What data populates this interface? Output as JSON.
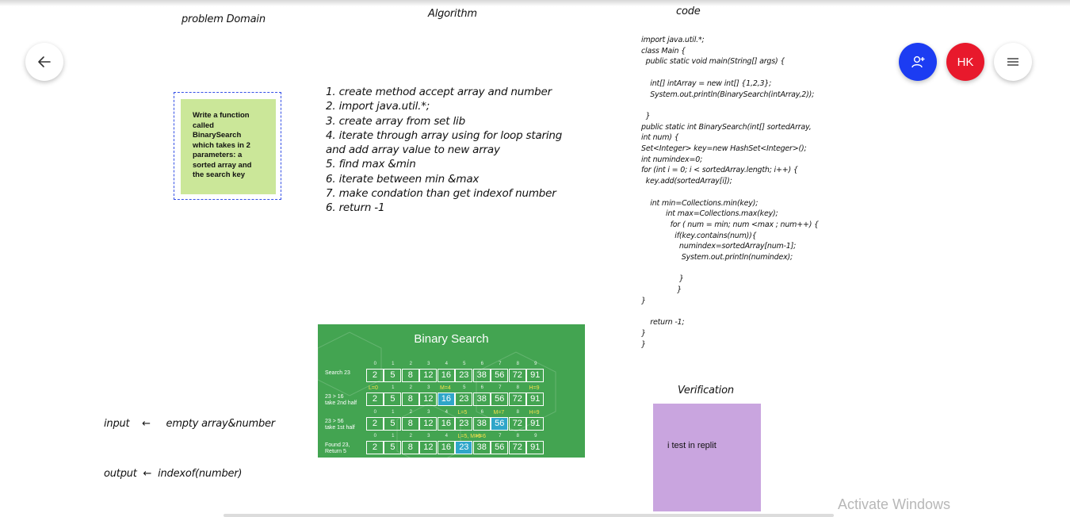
{
  "titles": {
    "problem_domain": "problem Domain",
    "algorithm": "Algorithm",
    "code": "code",
    "verification": "Verification"
  },
  "toolbar": {
    "back_icon": "arrow-left-icon",
    "share_icon": "add-user-icon",
    "avatar_initials": "HK",
    "menu_icon": "hamburger-menu-icon",
    "share_color": "#1c3cf2",
    "avatar_color": "#e8192c"
  },
  "problem_note": {
    "text": "Write a function called BinarySearch which takes in 2 parameters: a sorted array and the search key",
    "color": "#cbe799"
  },
  "algorithm_steps": [
    "1. create method accept array and number",
    "2. import java.util.*;",
    "3. create array from set lib",
    "4. iterate through array using for loop staring",
    "and add array value to new array",
    "5. find max &min",
    "6.  iterate between min &max",
    "7. make condation than get indexof number",
    "6. return -1"
  ],
  "code_lines": [
    "import java.util.*;",
    "class Main {",
    "  public static void main(String[] args) {",
    "",
    "    int[] intArray = new int[] {1,2,3};",
    "    System.out.println(BinarySearch(intArray,2));",
    "",
    "  }",
    "public static int BinarySearch(int[] sortedArray,",
    "int num) {",
    "Set<Integer> key=new HashSet<Integer>();",
    "int numindex=0;",
    "for (int i = 0; i < sortedArray.length; i++) {",
    "  key.add(sortedArray[i]);",
    "",
    "    int min=Collections.min(key);",
    "           int max=Collections.max(key);",
    "             for ( num = min; num <max ; num++) {",
    "               if(key.contains(num)){",
    "                 numindex=sortedArray[num-1];",
    "                  System.out.println(numindex);",
    "",
    "                 }",
    "                }",
    "}",
    "",
    "    return -1;",
    "}",
    "}"
  ],
  "io": {
    "input_line": "input    ←     empty array&number",
    "output_line": "output  ←  indexof(number)"
  },
  "binary_search_image": {
    "title": "Binary Search",
    "values": [
      "2",
      "5",
      "8",
      "12",
      "16",
      "23",
      "38",
      "56",
      "72",
      "91"
    ],
    "indices": [
      "0",
      "1",
      "2",
      "3",
      "4",
      "5",
      "6",
      "7",
      "8",
      "9"
    ],
    "rows": [
      {
        "label": "Search 23",
        "highlight": -1,
        "marks": []
      },
      {
        "label": "23 > 16\ntake 2nd half",
        "highlight": 4,
        "marks": [
          {
            "text": "L=0",
            "at": 0
          },
          {
            "text": "M=4",
            "at": 4
          },
          {
            "text": "H=9",
            "at": 9
          }
        ]
      },
      {
        "label": "23 > 56\ntake 1st half",
        "highlight": 7,
        "marks": [
          {
            "text": "L=5",
            "at": 5
          },
          {
            "text": "M=7",
            "at": 7
          },
          {
            "text": "H=9",
            "at": 9
          }
        ]
      },
      {
        "label": "Found 23,\nReturn 5",
        "highlight": 5,
        "marks": [
          {
            "text": "L=5, M=5",
            "at": 5
          },
          {
            "text": "H=6",
            "at": 6
          }
        ]
      }
    ],
    "background": "#43a451",
    "highlight_color": "#2fa6c9"
  },
  "verification_note": {
    "text": "i test in replit",
    "color": "#c9a5df"
  },
  "watermark": "Activate Windows"
}
